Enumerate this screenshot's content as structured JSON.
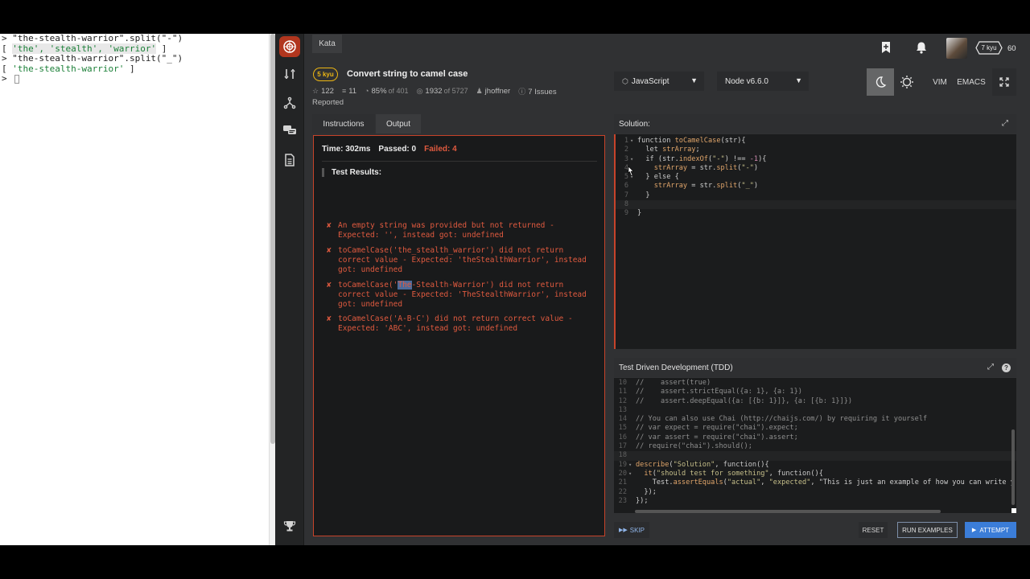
{
  "console": {
    "lines": [
      {
        "prompt": "> ",
        "text": "\"the-stealth-warrior\".split(\"-\")"
      },
      {
        "prompt": "[ ",
        "items": [
          "'the'",
          "'stealth'",
          "'warrior'"
        ],
        "close": " ]"
      },
      {
        "prompt": "> ",
        "text": "\"the-stealth-warrior\".split(\"_\")"
      },
      {
        "prompt": "[ ",
        "items": [
          "'the-stealth-warrior'"
        ],
        "close": " ]"
      },
      {
        "prompt": "> ",
        "text": ""
      }
    ]
  },
  "header": {
    "kata_tab": "Kata",
    "kyu": "5 kyu",
    "title": "Convert string to camel case",
    "stats": {
      "votes": "122",
      "collections": "11",
      "satisfaction": "85%",
      "satisfaction_of": "of 401",
      "completed": "1932",
      "completed_of": "of 5727",
      "author": "jhoffner",
      "issues": "7 Issues"
    },
    "reported": "Reported",
    "rank": "7 kyu",
    "honor": "60"
  },
  "selects": {
    "language": "JavaScript",
    "version": "Node v6.6.0"
  },
  "editor_modes": {
    "vim": "VIM",
    "emacs": "EMACS"
  },
  "tabs": {
    "instructions": "Instructions",
    "output": "Output"
  },
  "output": {
    "time": "Time: 302ms",
    "passed": "Passed: 0",
    "failed": "Failed: 4",
    "results_heading": "Test Results:",
    "failures": [
      {
        "text": "An empty string was provided but not returned - Expected: '', instead got: undefined"
      },
      {
        "text": "toCamelCase('the_stealth_warrior') did not return correct value - Expected: 'theStealthWarrior', instead got: undefined"
      },
      {
        "pre": "toCamelCase('",
        "hl": "The",
        "post": "-Stealth-Warrior') did not return correct value - Expected: 'TheStealthWarrior', instead got: undefined"
      },
      {
        "text": "toCamelCase('A-B-C') did not return correct value - Expected: 'ABC', instead got: undefined"
      }
    ]
  },
  "solution": {
    "heading": "Solution:",
    "lines": [
      {
        "n": "1",
        "fold": true,
        "code": "function toCamelCase(str){"
      },
      {
        "n": "2",
        "code": "  let strArray;"
      },
      {
        "n": "3",
        "fold": true,
        "code": "  if (str.indexOf(\"-\") !== -1){"
      },
      {
        "n": "4",
        "code": "    strArray = str.split(\"-\")"
      },
      {
        "n": "5",
        "fold": true,
        "code": "  } else {"
      },
      {
        "n": "6",
        "code": "    strArray = str.split(\"_\")"
      },
      {
        "n": "7",
        "code": "  }"
      },
      {
        "n": "8",
        "code": "",
        "current": true
      },
      {
        "n": "9",
        "code": "}"
      }
    ]
  },
  "tdd": {
    "heading": "Test Driven Development (TDD)",
    "lines": [
      {
        "n": "10",
        "code": "//    assert(true)"
      },
      {
        "n": "11",
        "code": "//    assert.strictEqual({a: 1}, {a: 1})"
      },
      {
        "n": "12",
        "code": "//    assert.deepEqual({a: [{b: 1}]}, {a: [{b: 1}]})"
      },
      {
        "n": "13",
        "code": ""
      },
      {
        "n": "14",
        "code": "// You can also use Chai (http://chaijs.com/) by requiring it yourself"
      },
      {
        "n": "15",
        "code": "// var expect = require(\"chai\").expect;"
      },
      {
        "n": "16",
        "code": "// var assert = require(\"chai\").assert;"
      },
      {
        "n": "17",
        "code": "// require(\"chai\").should();"
      },
      {
        "n": "18",
        "code": "",
        "current": true
      },
      {
        "n": "19",
        "fold": true,
        "code": "describe(\"Solution\", function(){"
      },
      {
        "n": "20",
        "fold": true,
        "code": "  it(\"should test for something\", function(){"
      },
      {
        "n": "21",
        "code": "    Test.assertEquals(\"actual\", \"expected\", \"This is just an example of how you can write y"
      },
      {
        "n": "22",
        "code": "  });"
      },
      {
        "n": "23",
        "code": "});"
      }
    ]
  },
  "buttons": {
    "skip": "SKIP",
    "reset": "RESET",
    "run_examples": "RUN EXAMPLES",
    "attempt": "ATTEMPT"
  },
  "colors": {
    "accent_red": "#c7432a",
    "fail_text": "#e05a3f",
    "kyu_yellow": "#ecb613",
    "attempt_blue": "#3b7dd8"
  }
}
